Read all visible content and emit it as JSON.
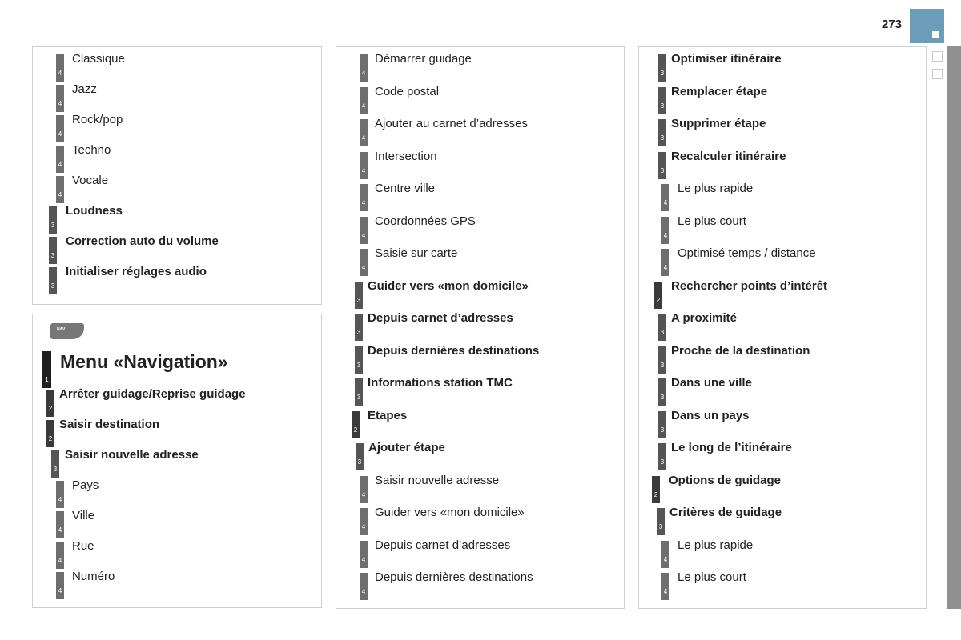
{
  "page": {
    "number": "273",
    "accent_color": "#6b9db8"
  },
  "panels": [
    {
      "id": "audio-settings",
      "items": [
        {
          "level": "4",
          "label": "Classique",
          "bold": false
        },
        {
          "level": "4",
          "label": "Jazz",
          "bold": false
        },
        {
          "level": "4",
          "label": "Rock/pop",
          "bold": false
        },
        {
          "level": "4",
          "label": "Techno",
          "bold": false
        },
        {
          "level": "4",
          "label": "Vocale",
          "bold": false
        },
        {
          "level": "3",
          "label": "Loudness",
          "bold": true
        },
        {
          "level": "3",
          "label": "Correction auto du volume",
          "bold": true
        },
        {
          "level": "3",
          "label": "Initialiser réglages audio",
          "bold": true
        }
      ]
    },
    {
      "id": "navigation-menu",
      "key_icon_label": "NAV",
      "items": [
        {
          "level": "1",
          "label": "Menu «Navigation»",
          "bold": true
        },
        {
          "level": "2",
          "label": "Arrêter guidage/Reprise guidage",
          "bold": true
        },
        {
          "level": "2",
          "label": "Saisir destination",
          "bold": true
        },
        {
          "level": "3",
          "label": "Saisir nouvelle adresse",
          "bold": true
        },
        {
          "level": "4",
          "label": "Pays",
          "bold": false
        },
        {
          "level": "4",
          "label": "Ville",
          "bold": false
        },
        {
          "level": "4",
          "label": "Rue",
          "bold": false
        },
        {
          "level": "4",
          "label": "Numéro",
          "bold": false
        }
      ]
    },
    {
      "id": "destination-entry",
      "items": [
        {
          "level": "4",
          "label": "Démarrer guidage",
          "bold": false
        },
        {
          "level": "4",
          "label": "Code postal",
          "bold": false
        },
        {
          "level": "4",
          "label": "Ajouter au carnet d’adresses",
          "bold": false
        },
        {
          "level": "4",
          "label": "Intersection",
          "bold": false
        },
        {
          "level": "4",
          "label": "Centre ville",
          "bold": false
        },
        {
          "level": "4",
          "label": "Coordonnées GPS",
          "bold": false
        },
        {
          "level": "4",
          "label": "Saisie sur carte",
          "bold": false
        },
        {
          "level": "3",
          "label": "Guider vers «mon domicile»",
          "bold": true
        },
        {
          "level": "3",
          "label": "Depuis carnet d’adresses",
          "bold": true
        },
        {
          "level": "3",
          "label": "Depuis dernières destinations",
          "bold": true
        },
        {
          "level": "3",
          "label": "Informations station TMC",
          "bold": true
        },
        {
          "level": "2",
          "label": "Etapes",
          "bold": true
        },
        {
          "level": "3",
          "label": "Ajouter étape",
          "bold": true
        },
        {
          "level": "4",
          "label": "Saisir nouvelle adresse",
          "bold": false
        },
        {
          "level": "4",
          "label": "Guider vers «mon domicile»",
          "bold": false
        },
        {
          "level": "4",
          "label": "Depuis carnet d’adresses",
          "bold": false
        },
        {
          "level": "4",
          "label": "Depuis dernières destinations",
          "bold": false
        }
      ]
    },
    {
      "id": "route-options",
      "items": [
        {
          "level": "3",
          "label": "Optimiser itinéraire",
          "bold": true
        },
        {
          "level": "3",
          "label": "Remplacer étape",
          "bold": true
        },
        {
          "level": "3",
          "label": "Supprimer étape",
          "bold": true
        },
        {
          "level": "3",
          "label": "Recalculer itinéraire",
          "bold": true
        },
        {
          "level": "4",
          "label": "Le plus rapide",
          "bold": false
        },
        {
          "level": "4",
          "label": "Le plus court",
          "bold": false
        },
        {
          "level": "4",
          "label": "Optimisé temps / distance",
          "bold": false
        },
        {
          "level": "2",
          "label": "Rechercher points d’intérêt",
          "bold": true
        },
        {
          "level": "3",
          "label": "A proximité",
          "bold": true
        },
        {
          "level": "3",
          "label": "Proche de la destination",
          "bold": true
        },
        {
          "level": "3",
          "label": "Dans une ville",
          "bold": true
        },
        {
          "level": "3",
          "label": "Dans un pays",
          "bold": true
        },
        {
          "level": "3",
          "label": "Le long de l’itinéraire",
          "bold": true
        },
        {
          "level": "2",
          "label": "Options de guidage",
          "bold": true
        },
        {
          "level": "3",
          "label": "Critères de guidage",
          "bold": true
        },
        {
          "level": "4",
          "label": "Le plus rapide",
          "bold": false
        },
        {
          "level": "4",
          "label": "Le plus court",
          "bold": false
        }
      ]
    }
  ]
}
